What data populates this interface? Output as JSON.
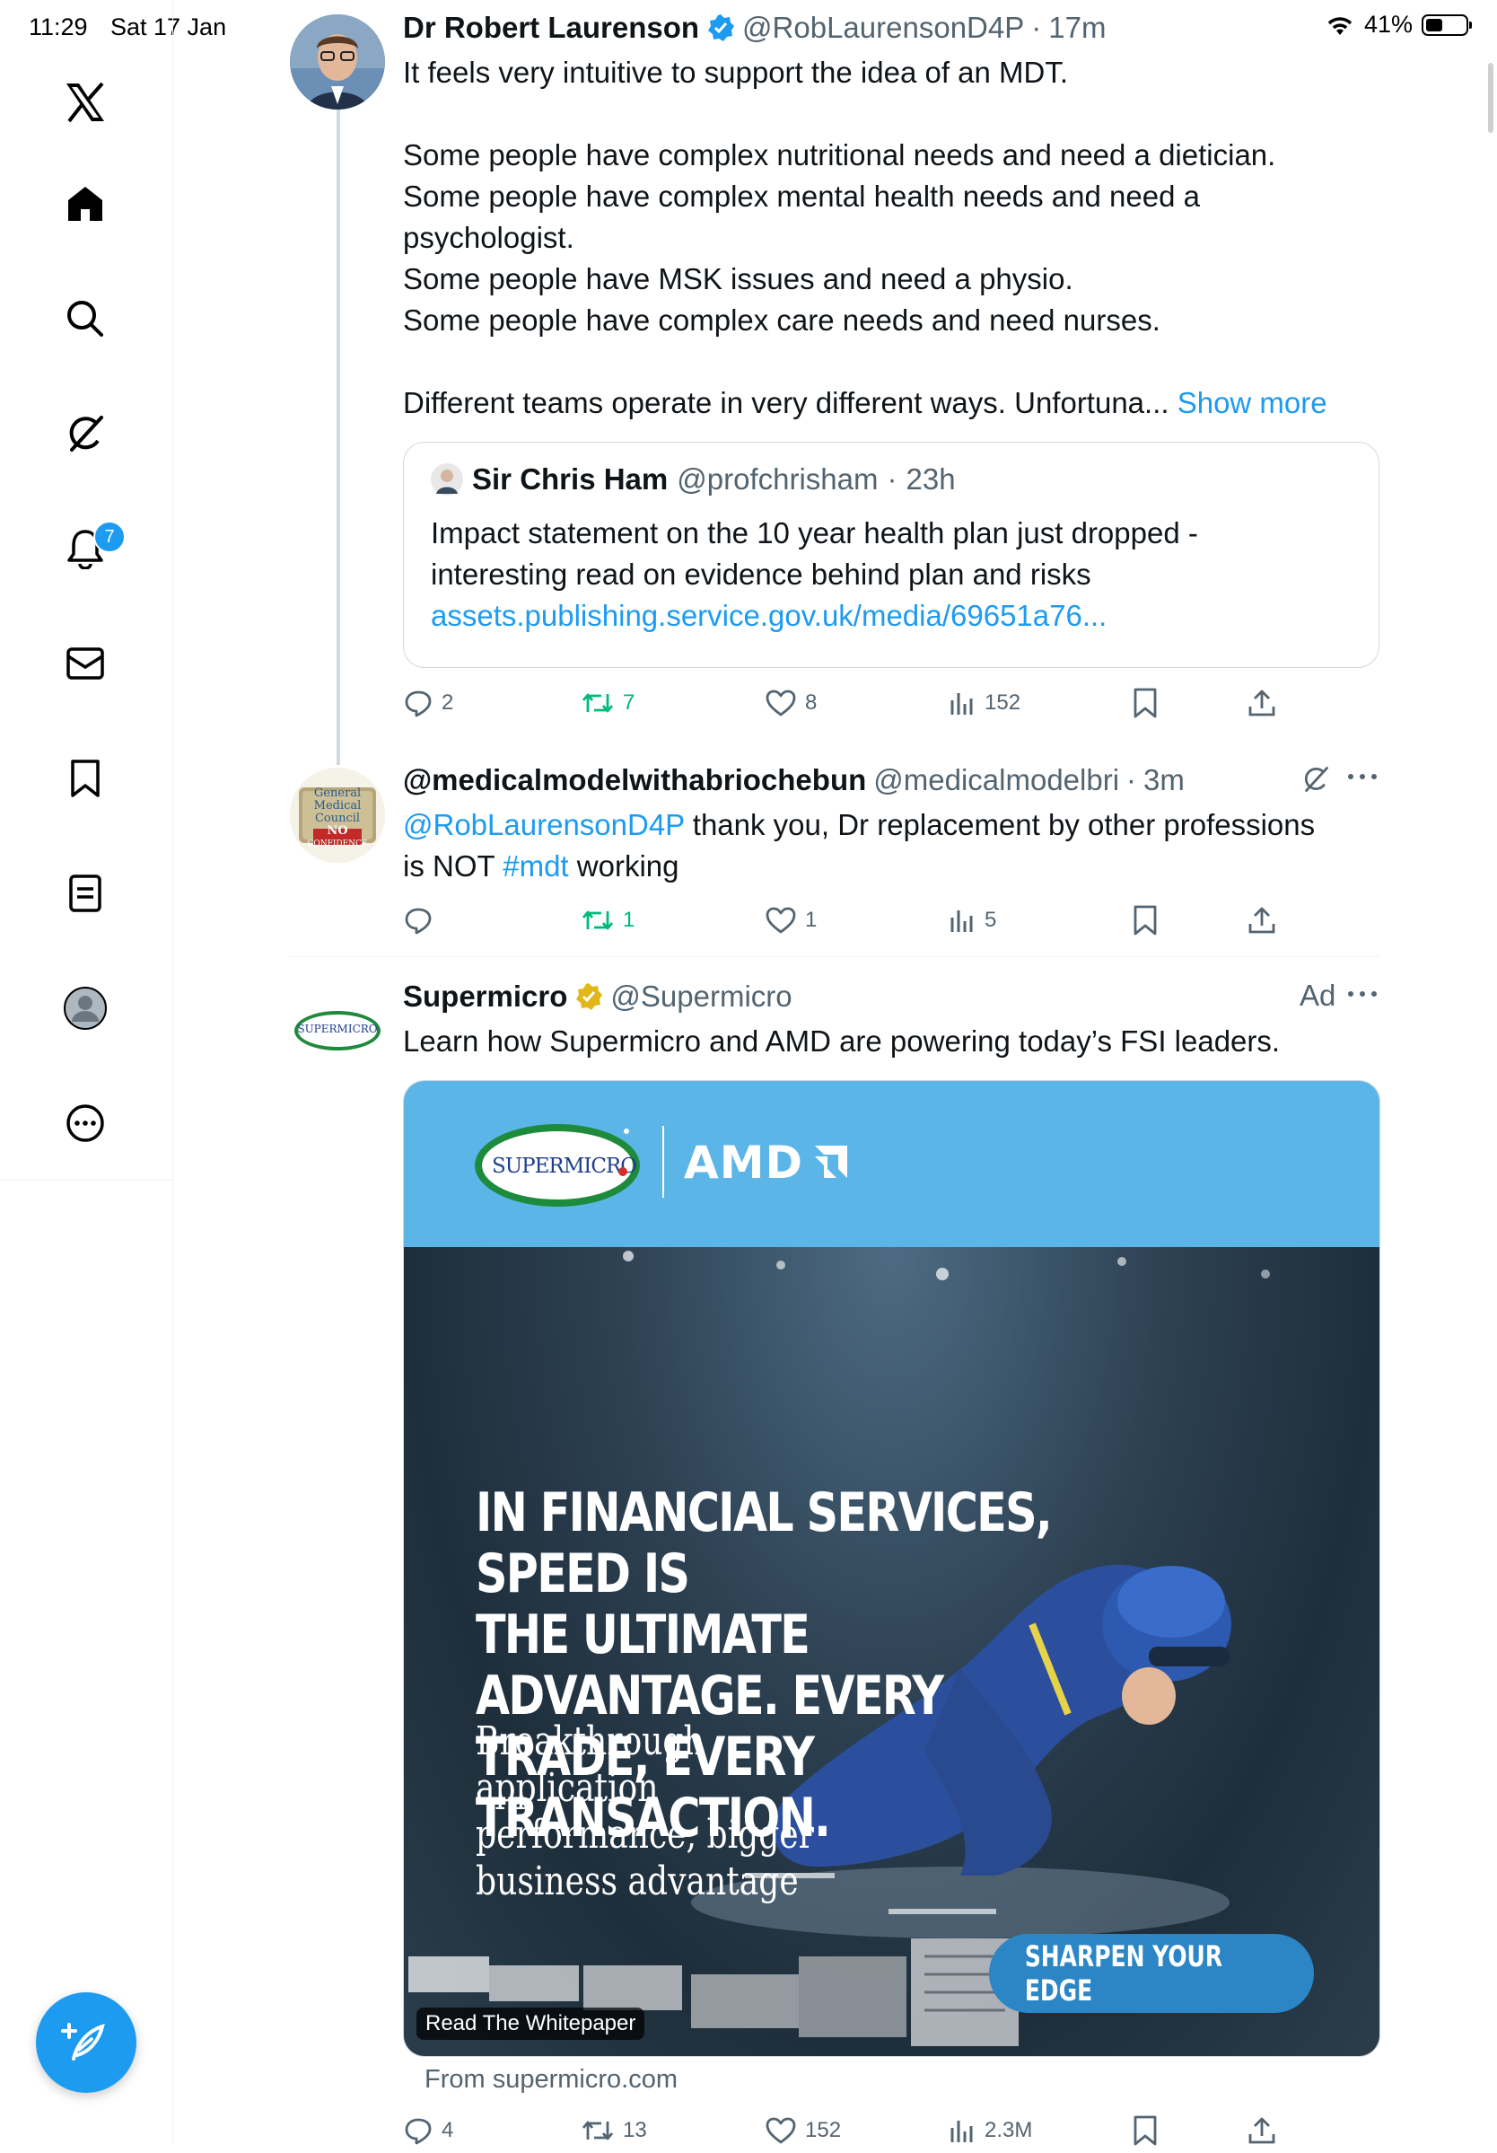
{
  "status_bar": {
    "time": "11:29",
    "date": "Sat 17 Jan",
    "battery": "41%",
    "battery_level": 0.41
  },
  "sidebar": {
    "notifications_badge": "7",
    "items": [
      {
        "name": "x-logo-icon"
      },
      {
        "name": "home-icon"
      },
      {
        "name": "search-icon"
      },
      {
        "name": "grok-icon"
      },
      {
        "name": "notifications-icon"
      },
      {
        "name": "messages-icon"
      },
      {
        "name": "bookmarks-icon"
      },
      {
        "name": "lists-icon"
      },
      {
        "name": "profile-icon"
      },
      {
        "name": "more-icon"
      }
    ]
  },
  "tweets": [
    {
      "name": "Dr Robert Laurenson",
      "handle": "@RobLaurensonD4P",
      "time": "17m",
      "lines": [
        "It feels very intuitive to support the idea of an MDT.",
        "",
        "Some people have complex nutritional needs and need a dietician.",
        "Some people have complex mental health needs and need a",
        "psychologist.",
        "Some people have MSK issues and need a physio.",
        "Some people have complex care needs and need nurses.",
        "",
        "Different teams operate in very different ways. Unfortuna..."
      ],
      "show_more": "Show more",
      "quote": {
        "name": "Sir Chris Ham",
        "handle": "@profchrisham",
        "time": "23h",
        "line1": "Impact statement on the 10 year health plan just dropped -",
        "line2": "interesting read on evidence behind plan and risks",
        "link": "assets.publishing.service.gov.uk/media/69651a76..."
      },
      "stats": {
        "replies": "2",
        "reposts": "7",
        "likes": "8",
        "views": "152"
      }
    },
    {
      "name": "@medicalmodelwithabriochebun",
      "handle": "@medicalmodelbri",
      "time": "3m",
      "mention": "@RobLaurensonD4P",
      "text1": " thank you, Dr replacement by other professions",
      "text2a": "is NOT ",
      "hashtag": "#mdt",
      "text2b": " working",
      "avatar_text": [
        "General",
        "Medical",
        "Council",
        "NO",
        "CONFIDENCE"
      ],
      "stats": {
        "replies": "",
        "reposts": "1",
        "likes": "1",
        "views": "5"
      }
    },
    {
      "name": "Supermicro",
      "handle": "@Supermicro",
      "ad_label": "Ad",
      "text": "Learn how Supermicro and AMD are powering today’s FSI leaders.",
      "avatar_text": "SUPERMICRO",
      "card": {
        "brand1": "SUPERMICRO",
        "brand2": "AMD",
        "headline": [
          "IN FINANCIAL SERVICES, SPEED IS",
          "THE ULTIMATE ADVANTAGE. EVERY",
          "TRADE, EVERY TRANSACTION."
        ],
        "subhead": [
          "Breakthrough",
          "application",
          "performance, bigger",
          "business advantage"
        ],
        "cta": "SHARPEN YOUR EDGE",
        "whitepaper_label": "Read The Whitepaper",
        "source": "From supermicro.com"
      },
      "stats": {
        "replies": "4",
        "reposts": "13",
        "likes": "152",
        "views": "2.3M"
      }
    }
  ],
  "colors": {
    "accent": "#1d9bf0",
    "repost": "#00ba7c",
    "verified_blue": "#1d9bf0",
    "verified_gold": "#e2b719"
  }
}
